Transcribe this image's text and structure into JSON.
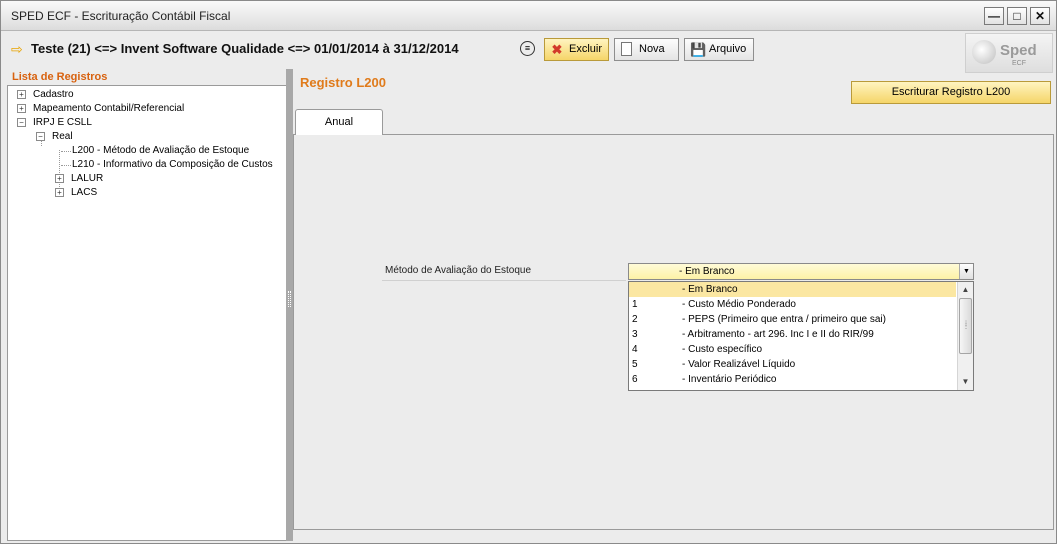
{
  "window": {
    "title": "SPED ECF - Escrituração Contábil Fiscal",
    "controls": {
      "minimize": "—",
      "maximize": "□",
      "close": "✕"
    }
  },
  "toolbar": {
    "heading": "Teste (21) <=> Invent Software Qualidade <=> 01/01/2014 à 31/12/2014",
    "menu_icon": "≡",
    "excluir_label": "Excluir",
    "nova_label": "Nova",
    "arquivo_label": "Arquivo"
  },
  "logo": {
    "text": "Sped",
    "sub": "ECF"
  },
  "sidebar": {
    "title": "Lista de Registros",
    "items": [
      {
        "label": "Cadastro",
        "expander": "+"
      },
      {
        "label": "Mapeamento Contabil/Referencial",
        "expander": "+"
      },
      {
        "label": "IRPJ E CSLL",
        "expander": "−"
      },
      {
        "label": "Real",
        "expander": "−"
      },
      {
        "label": "L200 - Método de Avaliação de Estoque"
      },
      {
        "label": "L210 - Informativo da Composição de Custos"
      },
      {
        "label": "LALUR",
        "expander": "+"
      },
      {
        "label": "LACS",
        "expander": "+"
      }
    ]
  },
  "main": {
    "title": "Registro L200",
    "escriturar_button": "Escriturar Registro L200",
    "tabs": [
      {
        "label": "Anual"
      }
    ],
    "field": {
      "label": "Método de Avaliação do Estoque",
      "selected": "- Em Branco"
    },
    "options": [
      {
        "code": "",
        "label": "- Em Branco"
      },
      {
        "code": "1",
        "label": "- Custo Médio Ponderado"
      },
      {
        "code": "2",
        "label": "- PEPS (Primeiro que entra / primeiro que sai)"
      },
      {
        "code": "3",
        "label": "- Arbitramento - art 296. Inc I e II do RIR/99"
      },
      {
        "code": "4",
        "label": "- Custo específico"
      },
      {
        "code": "5",
        "label": "- Valor Realizável Líquido"
      },
      {
        "code": "6",
        "label": "- Inventário Periódico"
      }
    ]
  }
}
